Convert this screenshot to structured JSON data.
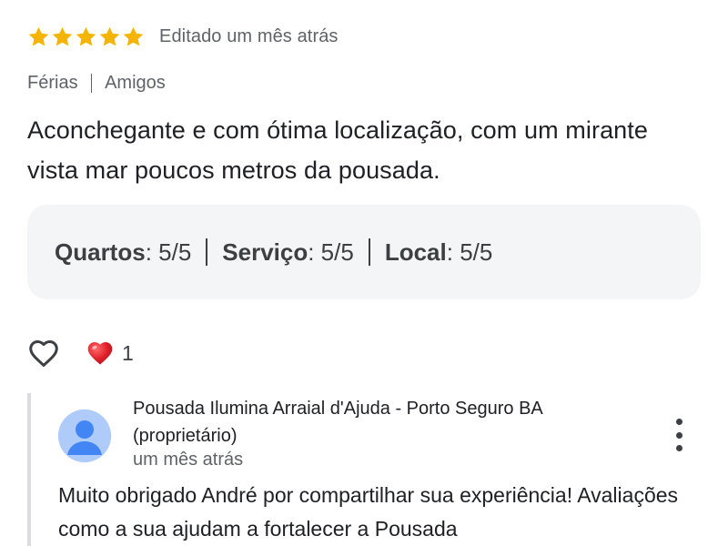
{
  "review": {
    "rating": 5,
    "rating_max": 5,
    "edited": "Editado um mês atrás",
    "tags": [
      "Férias",
      "Amigos"
    ],
    "text": "Aconchegante e com ótima localização, com um mirante vista mar poucos metros da pousada.",
    "subratings": [
      {
        "label": "Quartos",
        "value": ": 5/5"
      },
      {
        "label": "Serviço",
        "value": ": 5/5"
      },
      {
        "label": "Local",
        "value": ": 5/5"
      }
    ],
    "reactions": {
      "heart_count": "1"
    }
  },
  "owner_reply": {
    "owner_name": "Pousada Ilumina Arraial d'Ajuda - Porto Seguro BA (proprietário)",
    "time": "um mês atrás",
    "text": "Muito obrigado André por compartilhar sua experiência! Avaliações como a sua ajudam a fortalecer a Pousada"
  },
  "colors": {
    "star": "#f4b400",
    "muted_text": "#5f6368",
    "box_bg": "#f4f5f7",
    "heart_red": "#e0202a",
    "avatar_bg": "#aecbfa",
    "avatar_fg": "#4285f4"
  },
  "icons": {
    "star": "star-icon",
    "like": "heart-outline-icon",
    "reaction": "red-heart-emoji-icon",
    "avatar": "person-avatar-icon",
    "more": "more-vertical-icon"
  }
}
